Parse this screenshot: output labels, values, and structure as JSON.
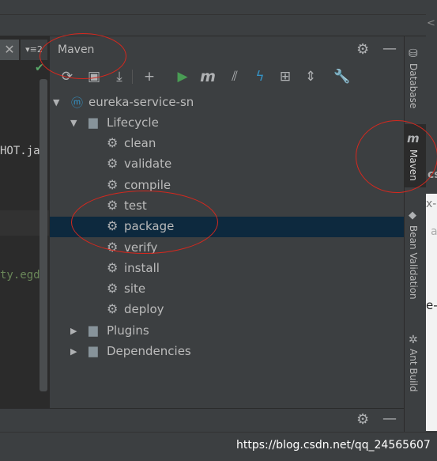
{
  "editor": {
    "tab_close": "✕",
    "tab_menu": "▾≡2",
    "line1": "HOT.ja",
    "line2": "ty.egd"
  },
  "panel": {
    "title": "Maven",
    "toolbar": [
      {
        "name": "refresh-icon",
        "glyph": "⟳",
        "color": "#afb1b3"
      },
      {
        "name": "generate-sources-icon",
        "glyph": "▣",
        "color": "#afb1b3"
      },
      {
        "name": "download-icon",
        "glyph": "⤓",
        "color": "#afb1b3"
      },
      {
        "name": "add-icon",
        "glyph": "+",
        "color": "#afb1b3"
      },
      {
        "name": "run-icon",
        "glyph": "▶",
        "color": "#499c54"
      },
      {
        "name": "execute-goal-icon",
        "glyph": "m",
        "color": "#afb1b3"
      },
      {
        "name": "toggle-offline-icon",
        "glyph": "⫽",
        "color": "#afb1b3"
      },
      {
        "name": "skip-tests-icon",
        "glyph": "ϟ",
        "color": "#3592c4"
      },
      {
        "name": "show-dependencies-icon",
        "glyph": "⊞",
        "color": "#afb1b3"
      },
      {
        "name": "collapse-all-icon",
        "glyph": "⇕",
        "color": "#afb1b3"
      },
      {
        "name": "settings-wrench-icon",
        "glyph": "🔧",
        "color": "#afb1b3"
      }
    ],
    "tree": {
      "project": "eureka-service-sn",
      "lifecycle": "Lifecycle",
      "goals": [
        "clean",
        "validate",
        "compile",
        "test",
        "package",
        "verify",
        "install",
        "site",
        "deploy"
      ],
      "selected_goal": "package",
      "plugins": "Plugins",
      "dependencies": "Dependencies"
    }
  },
  "right_strip": {
    "tabs": [
      "Database",
      "Maven",
      "Bean Validation",
      "Ant Build"
    ]
  },
  "far_right": {
    "c": "cs",
    "x": "x-",
    "a": "a",
    "e": "e-",
    "chev": "<"
  },
  "watermark": "https://blog.csdn.net/qq_24565607",
  "colors": {
    "panel_bg": "#3c3f41",
    "selection": "#0d293e",
    "annotation": "#d6281e"
  }
}
